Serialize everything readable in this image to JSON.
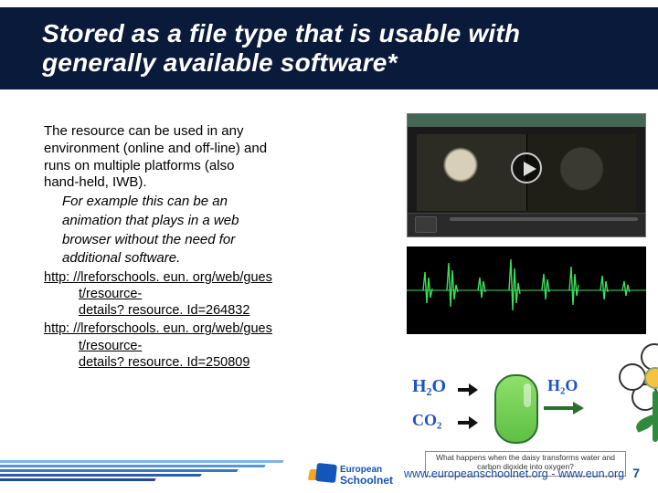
{
  "title": "Stored as a file type that is usable with generally available software*",
  "body": {
    "p1": "The resource can be used in any",
    "p2": "environment (online and off-line) and",
    "p3": "runs on multiple platforms (also",
    "p4": "hand-held, IWB).",
    "example1": "For example this can be an",
    "example2": "animation that plays in a web",
    "example3": "browser without the need for",
    "example4": "additional software.",
    "link1a": "http: //lreforschools. eun. org/web/gues",
    "link1b": "t/resource-",
    "link1c": "details? resource. Id=264832",
    "link2a": "http: //lreforschools. eun. org/web/gues",
    "link2b": "t/resource-",
    "link2c": "details? resource. Id=250809"
  },
  "molecules": {
    "h2o": "H₂O",
    "co2": "CO₂",
    "h2o2": "H₂O"
  },
  "diagram_caption": "What happens when the daisy transforms water and carbon dioxide into oxygen?",
  "logo": {
    "line1": "European",
    "line2": "Schoolnet"
  },
  "footer_url": "www.europeanschoolnet.org - www.eun.org",
  "page_number": "7"
}
